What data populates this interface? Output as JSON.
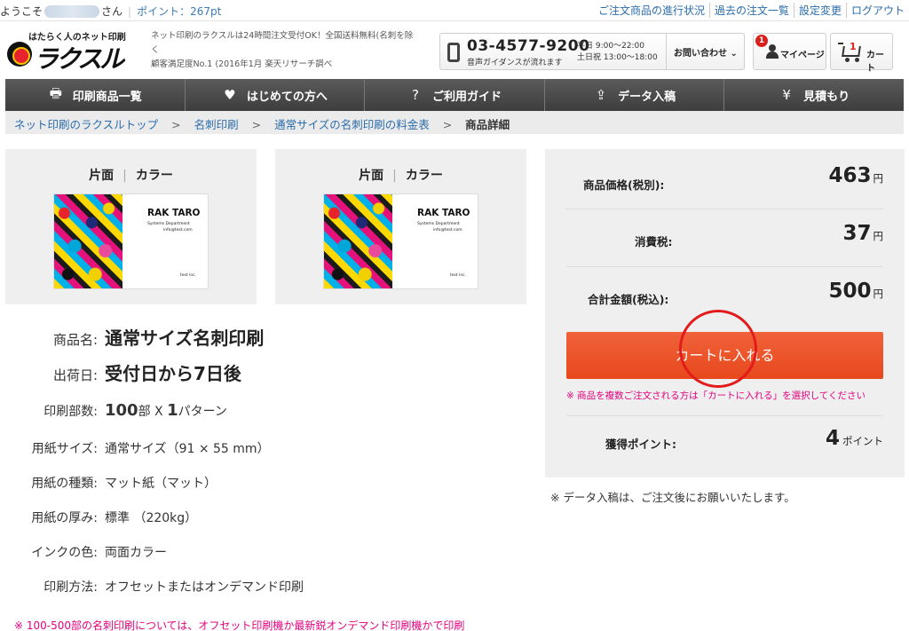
{
  "topbar": {
    "welcome_prefix": "ようこそ",
    "welcome_suffix": "さん",
    "points_text": "ポイント：267pt",
    "links": [
      "ご注文商品の進行状況",
      "過去の注文一覧",
      "設定変更",
      "ログアウト"
    ]
  },
  "header": {
    "logo_tagline": "はたらく人のネット印刷",
    "logo_text": "ラクスル",
    "description": "ネット印刷のラクスルは24時間注文受付OK！全国送料無料(名刺を除く",
    "rating": "顧客満足度No.1 (2016年1月 楽天リサーチ調べ",
    "phone": "03-4577-9200",
    "phone_note": "音声ガイダンスが流れます",
    "hours_weekday": "平日 9:00～22:00",
    "hours_weekend": "土日祝 13:00～18:00",
    "inquiry": "お問い合わせ",
    "mypage": "マイページ",
    "mypage_badge": "1",
    "cart": "カート",
    "cart_count": "1"
  },
  "nav": [
    {
      "icon": "printer-icon",
      "label": "印刷商品一覧"
    },
    {
      "icon": "heart-icon",
      "label": "はじめての方へ"
    },
    {
      "icon": "help-icon",
      "label": "ご利用ガイド"
    },
    {
      "icon": "upload-icon",
      "label": "データ入稿"
    },
    {
      "icon": "yen-icon",
      "label": "見積もり"
    }
  ],
  "breadcrumb": {
    "items": [
      "ネット印刷のラクスルトップ",
      "名刺印刷",
      "通常サイズの名刺印刷の料金表"
    ],
    "current": "商品詳細"
  },
  "previews": [
    {
      "side": "片面",
      "color": "カラー"
    },
    {
      "side": "片面",
      "color": "カラー"
    }
  ],
  "card_sample": {
    "name": "RAK TARO",
    "department": "Systems Department",
    "email": "info@test.com",
    "company": "test inc."
  },
  "details": {
    "product_label": "商品名:",
    "product_value": "通常サイズ名刺印刷",
    "ship_label": "出荷日:",
    "ship_value": "受付日から7日後",
    "qty_label": "印刷部数:",
    "qty_count": "100",
    "qty_unit": "部",
    "qty_times": "X",
    "qty_patterns": "1",
    "qty_pattern_unit": "パターン",
    "paper_size_label": "用紙サイズ:",
    "paper_size_value": "通常サイズ（91 × 55 mm）",
    "paper_type_label": "用紙の種類:",
    "paper_type_value": "マット紙（マット）",
    "thickness_label": "用紙の厚み:",
    "thickness_value": "標準 （220kg）",
    "ink_label": "インクの色:",
    "ink_value": "両面カラー",
    "method_label": "印刷方法:",
    "method_value": "オフセットまたはオンデマンド印刷",
    "note": "※  100-500部の名刺印刷については、オフセット印刷機か最新鋭オンデマンド印刷機かで印刷"
  },
  "price": {
    "price_label": "商品価格(税別):",
    "price_value": "463",
    "tax_label": "消費税:",
    "tax_value": "37",
    "total_label": "合計金額(税込):",
    "total_value": "500",
    "currency": "円",
    "add_to_cart": "カートに入れる",
    "cart_note": "※ 商品を複数ご注文される方は「カートに入れる」を選択してください",
    "points_label": "獲得ポイント:",
    "points_value": "4",
    "points_unit": "ポイント",
    "data_note": "※ データ入稿は、ご注文後にお願いいたします。"
  },
  "colors": {
    "accent": "#e8481c",
    "link": "#2a6cab",
    "note_pink": "#e4007f",
    "nav_bg": "#4a4a4a"
  }
}
